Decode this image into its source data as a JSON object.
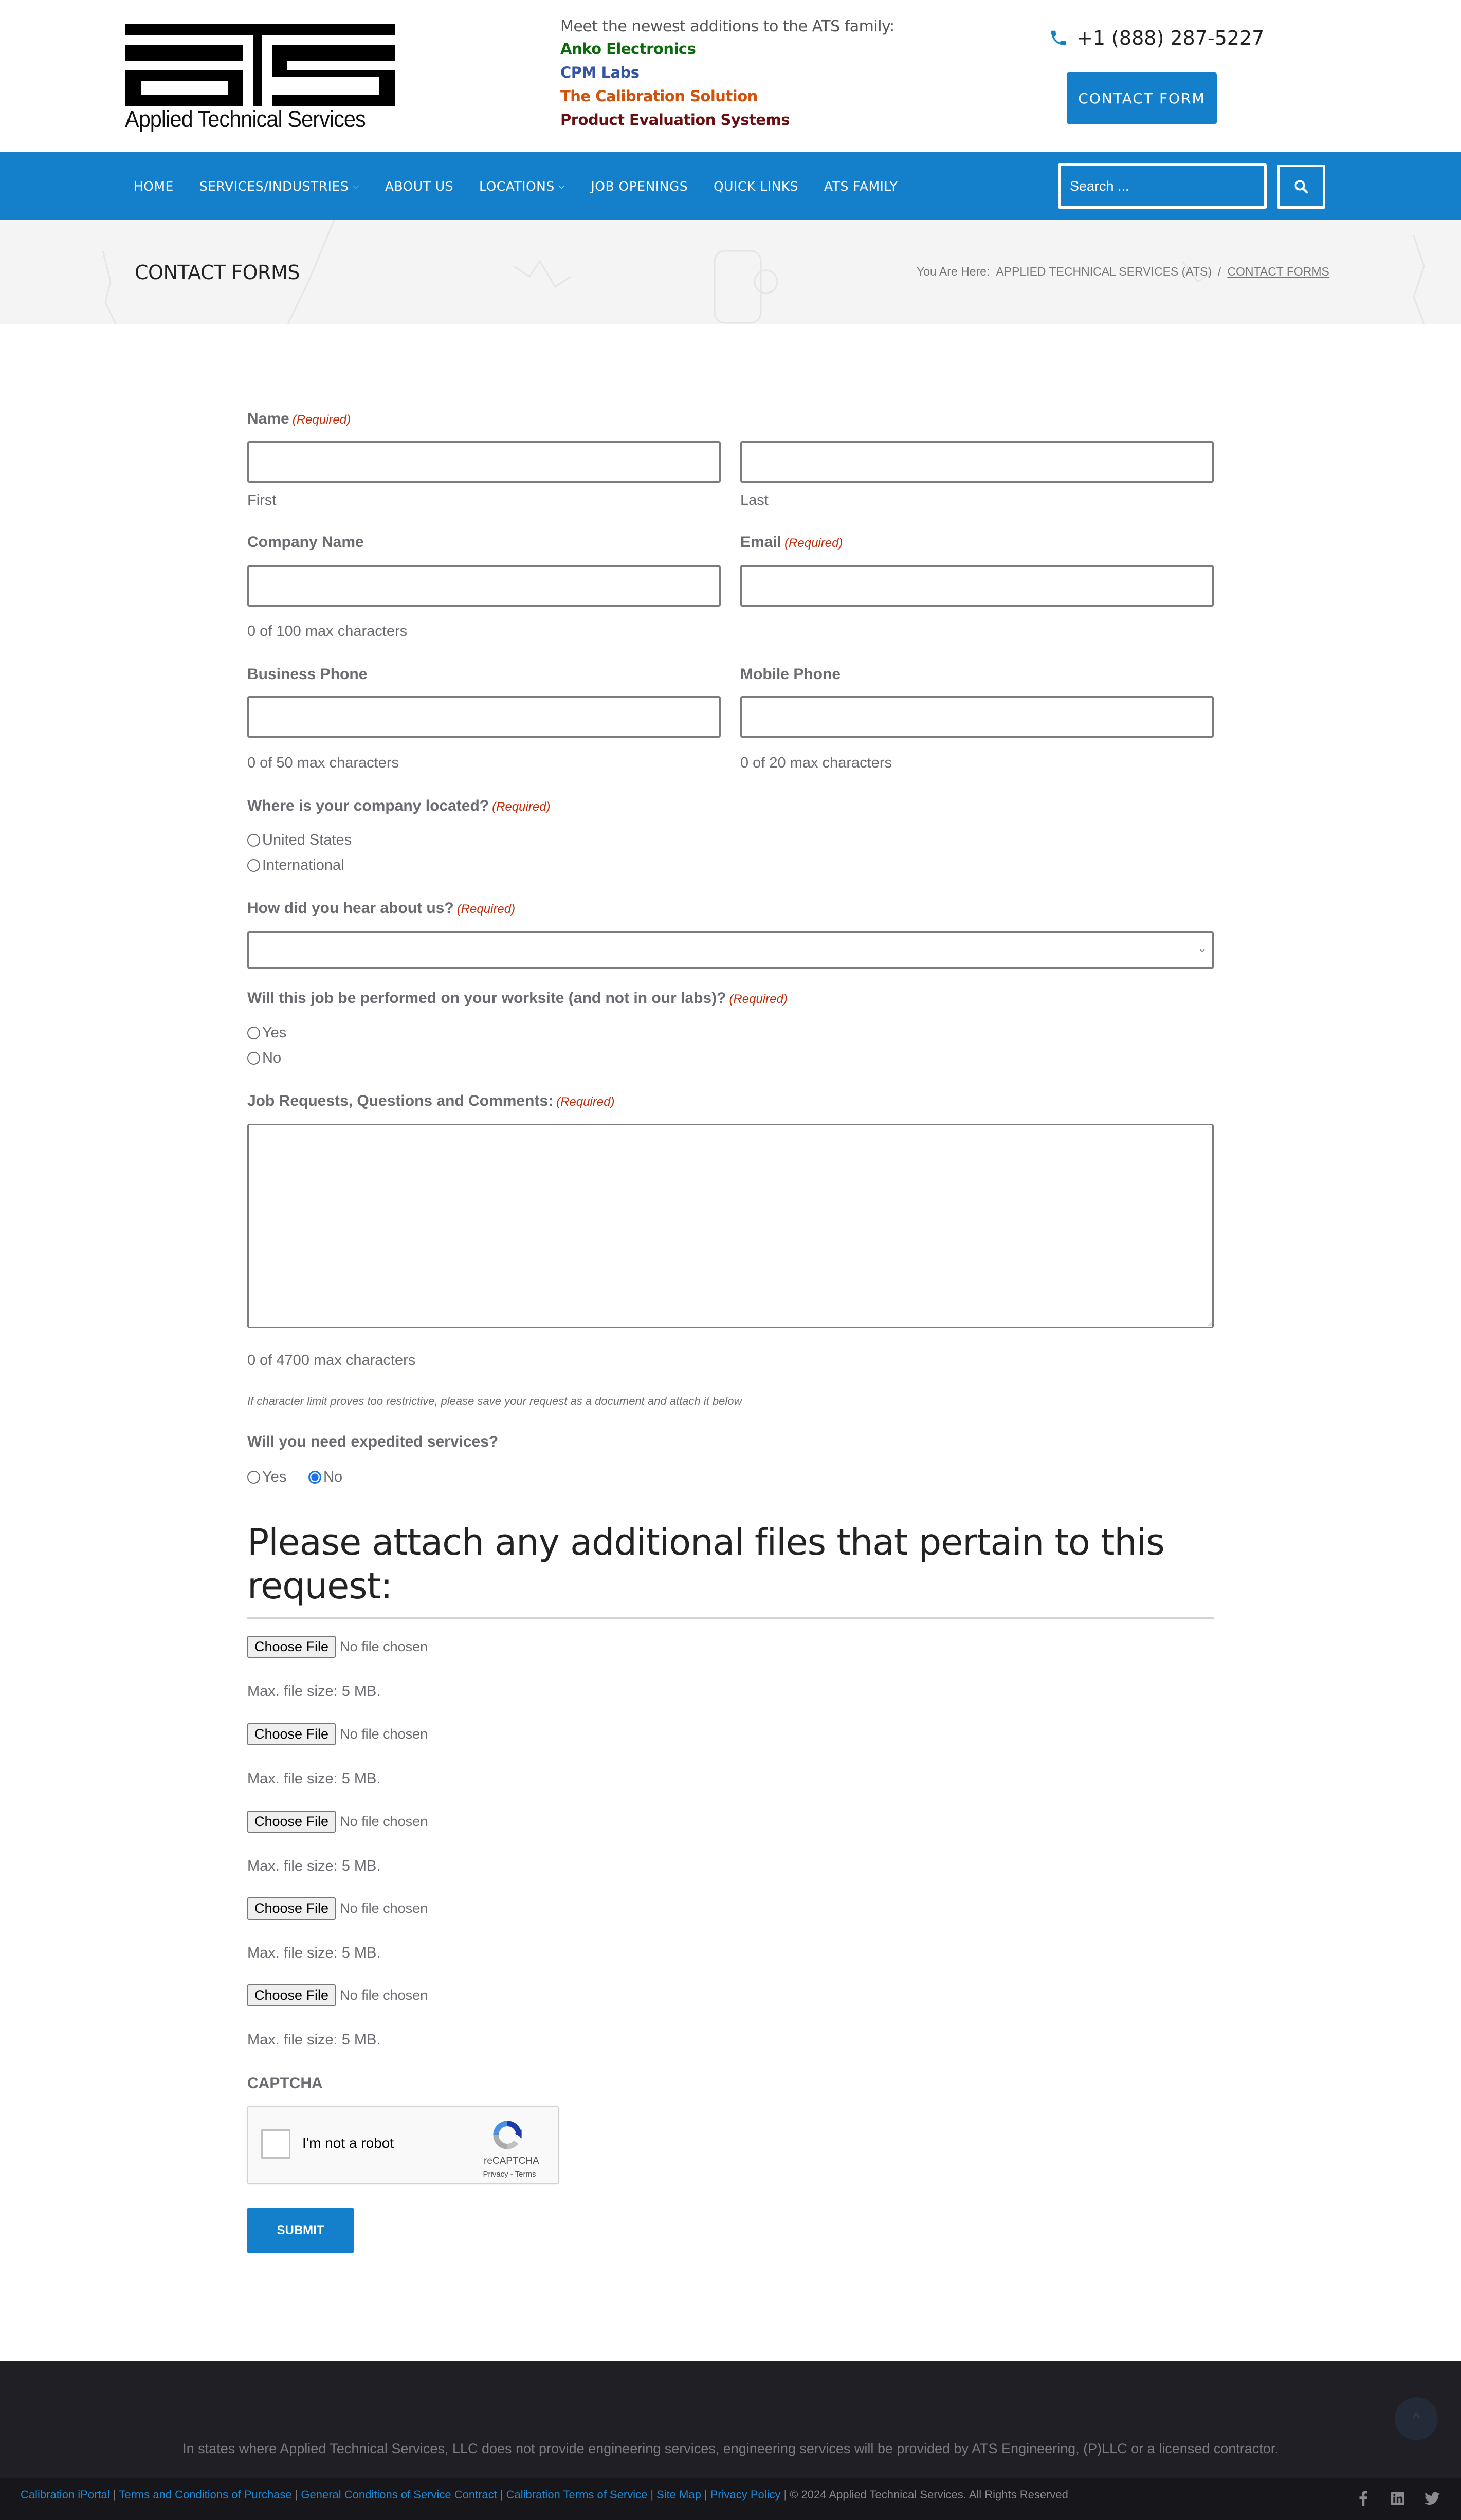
{
  "header": {
    "logo_text": "Applied Technical Services",
    "family_intro": "Meet the newest additions to the ATS family:",
    "family_links": [
      {
        "label": "Anko Electronics",
        "color": "#0b6a0b"
      },
      {
        "label": "CPM Labs",
        "color": "#3455a4"
      },
      {
        "label": "The Calibration Solution",
        "color": "#d2520c"
      },
      {
        "label": "Product Evaluation Systems",
        "color": "#6b0f12"
      }
    ],
    "phone": "+1 (888) 287-5227",
    "contact_button": "CONTACT FORM"
  },
  "nav": {
    "items": [
      {
        "label": "HOME",
        "dropdown": false
      },
      {
        "label": "SERVICES/INDUSTRIES",
        "dropdown": true
      },
      {
        "label": "ABOUT US",
        "dropdown": false
      },
      {
        "label": "LOCATIONS",
        "dropdown": true
      },
      {
        "label": "JOB OPENINGS",
        "dropdown": false
      },
      {
        "label": "QUICK LINKS",
        "dropdown": false
      },
      {
        "label": "ATS FAMILY",
        "dropdown": false
      }
    ],
    "search_placeholder": "Search ..."
  },
  "title_band": {
    "title": "CONTACT FORMS",
    "breadcrumb_prefix": "You Are Here:",
    "breadcrumb": [
      "APPLIED TECHNICAL SERVICES (ATS)",
      "/",
      "CONTACT FORMS"
    ]
  },
  "form": {
    "required_text": "(Required)",
    "name": {
      "label": "Name",
      "first": "First",
      "last": "Last",
      "first_value": "",
      "last_value": ""
    },
    "company": {
      "label": "Company Name",
      "value": "",
      "counter": "0 of 100 max characters"
    },
    "email": {
      "label": "Email",
      "value": ""
    },
    "business_phone": {
      "label": "Business Phone",
      "value": "",
      "counter": "0 of 50 max characters"
    },
    "mobile_phone": {
      "label": "Mobile Phone",
      "value": "",
      "counter": "0 of 20 max characters"
    },
    "location": {
      "label": "Where is your company located?",
      "options": [
        "United States",
        "International"
      ],
      "selected": null
    },
    "hear": {
      "label": "How did you hear about us?",
      "selected": ""
    },
    "worksite": {
      "label": "Will this job be performed on your worksite (and not in our labs)?",
      "options": [
        "Yes",
        "No"
      ],
      "selected": null
    },
    "comments": {
      "label": "Job Requests, Questions and Comments:",
      "value": "",
      "counter": "0 of 4700 max characters"
    },
    "hint": "If character limit proves too restrictive, please save your request as a document and attach it below",
    "expedited": {
      "label": "Will you need expedited services?",
      "options": [
        "Yes",
        "No"
      ],
      "selected": "No"
    },
    "attach_heading": "Please attach any additional files that pertain to this request:",
    "file_button": "Choose File",
    "file_none": "No file chosen",
    "file_max": "Max. file size: 5 MB.",
    "file_count": 5,
    "captcha_label": "CAPTCHA",
    "recaptcha": {
      "label": "I'm not a robot",
      "brand": "reCAPTCHA",
      "links": "Privacy - Terms"
    },
    "submit": "SUBMIT"
  },
  "footer": {
    "note": "In states where Applied Technical Services, LLC does not provide engineering services, engineering services will be provided by ATS Engineering, (P)LLC or a licensed contractor.",
    "links": [
      "Calibration iPortal",
      "Terms and Conditions of Purchase",
      "General Conditions of Service Contract",
      "Calibration Terms of Service",
      "Site Map",
      "Privacy Policy"
    ],
    "copyright": "© 2024 Applied Technical Services. All Rights Reserved",
    "social": [
      "facebook-icon",
      "linkedin-icon",
      "twitter-icon"
    ]
  },
  "colors": {
    "accent": "#1480cc",
    "required": "#c02b0a",
    "footer_bg": "#1f1f25",
    "link": "#1a8ad8"
  }
}
